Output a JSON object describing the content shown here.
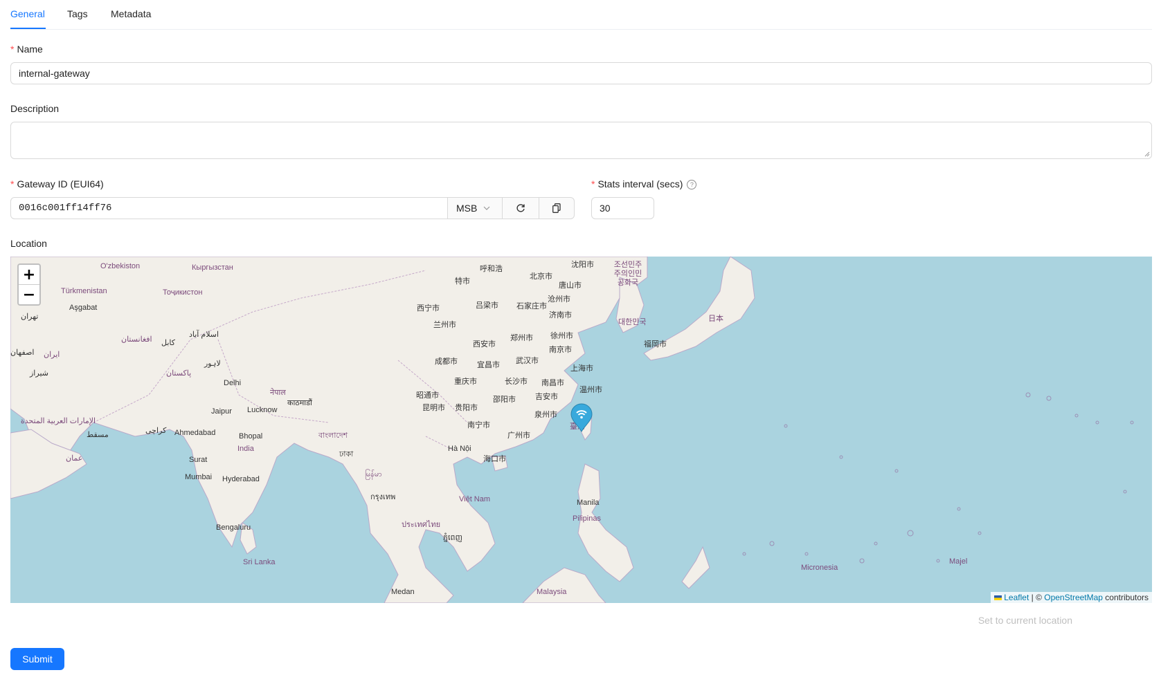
{
  "tabs": [
    {
      "label": "General",
      "active": true
    },
    {
      "label": "Tags",
      "active": false
    },
    {
      "label": "Metadata",
      "active": false
    }
  ],
  "form": {
    "name": {
      "label": "Name",
      "required": true,
      "value": "internal-gateway"
    },
    "description": {
      "label": "Description",
      "required": false,
      "value": ""
    },
    "gateway_id": {
      "label": "Gateway ID (EUI64)",
      "required": true,
      "value": "0016c001ff14ff76",
      "byte_order": "MSB"
    },
    "stats_interval": {
      "label": "Stats interval (secs)",
      "required": true,
      "value": "30"
    },
    "location": {
      "label": "Location"
    }
  },
  "map": {
    "zoom_in": "+",
    "zoom_out": "−",
    "attribution": {
      "leaflet": "Leaflet",
      "separator": " | © ",
      "osm": "OpenStreetMap",
      "suffix": " contributors"
    },
    "labels": [
      "O'zbekiston",
      "Кыргызстан",
      "Türkmenistan",
      "Aşgabat",
      "Тоҷикистон",
      "تهران",
      "افغانستان",
      "اسلام آباد",
      "كابل",
      "ایران",
      "اصفهان",
      "شیراز",
      "لاہور",
      "پاکستان",
      "Delhi",
      "नेपाल",
      "काठमाडौं",
      "Jaipur",
      "Lucknow",
      "الإمارات العربية المتحدة",
      "مسقط",
      "کراچی",
      "Ahmedabad",
      "Bhopal",
      "India",
      "عمان",
      "Surat",
      "Mumbai",
      "Hyderabad",
      "Bengaluru",
      "Sri Lanka",
      "বাংলাদেশ",
      "ঢাকা",
      "မြန်မာ",
      "ประเทศไทย",
      "กรุงเทพ",
      "Việt Nam",
      "Hà Nội",
      "ភ្នំពេញ",
      "Medan",
      "Malaysia",
      "呼和浩",
      "特市",
      "北京市",
      "沈阳市",
      "唐山市",
      "西宁市",
      "吕梁市",
      "石家庄市",
      "沧州市",
      "兰州市",
      "济南市",
      "西安市",
      "郑州市",
      "徐州市",
      "南京市",
      "成都市",
      "宜昌市",
      "武汉市",
      "上海市",
      "重庆市",
      "长沙市",
      "南昌市",
      "温州市",
      "昭通市",
      "贵阳市",
      "邵阳市",
      "吉安市",
      "昆明市",
      "泉州市",
      "南宁市",
      "广州市",
      "海口市",
      "臺灣",
      "조선민주주의인민공화국",
      "대한민국",
      "福岡市",
      "日本",
      "Manila",
      "Pilipinas",
      "Micronesia",
      "Majel"
    ]
  },
  "actions": {
    "set_location": "Set to current location",
    "submit": "Submit"
  },
  "colors": {
    "primary": "#1677ff",
    "required": "#ff4d4f",
    "map_water": "#aad3df",
    "map_land": "#f2efe9",
    "marker": "#38a9dc"
  }
}
